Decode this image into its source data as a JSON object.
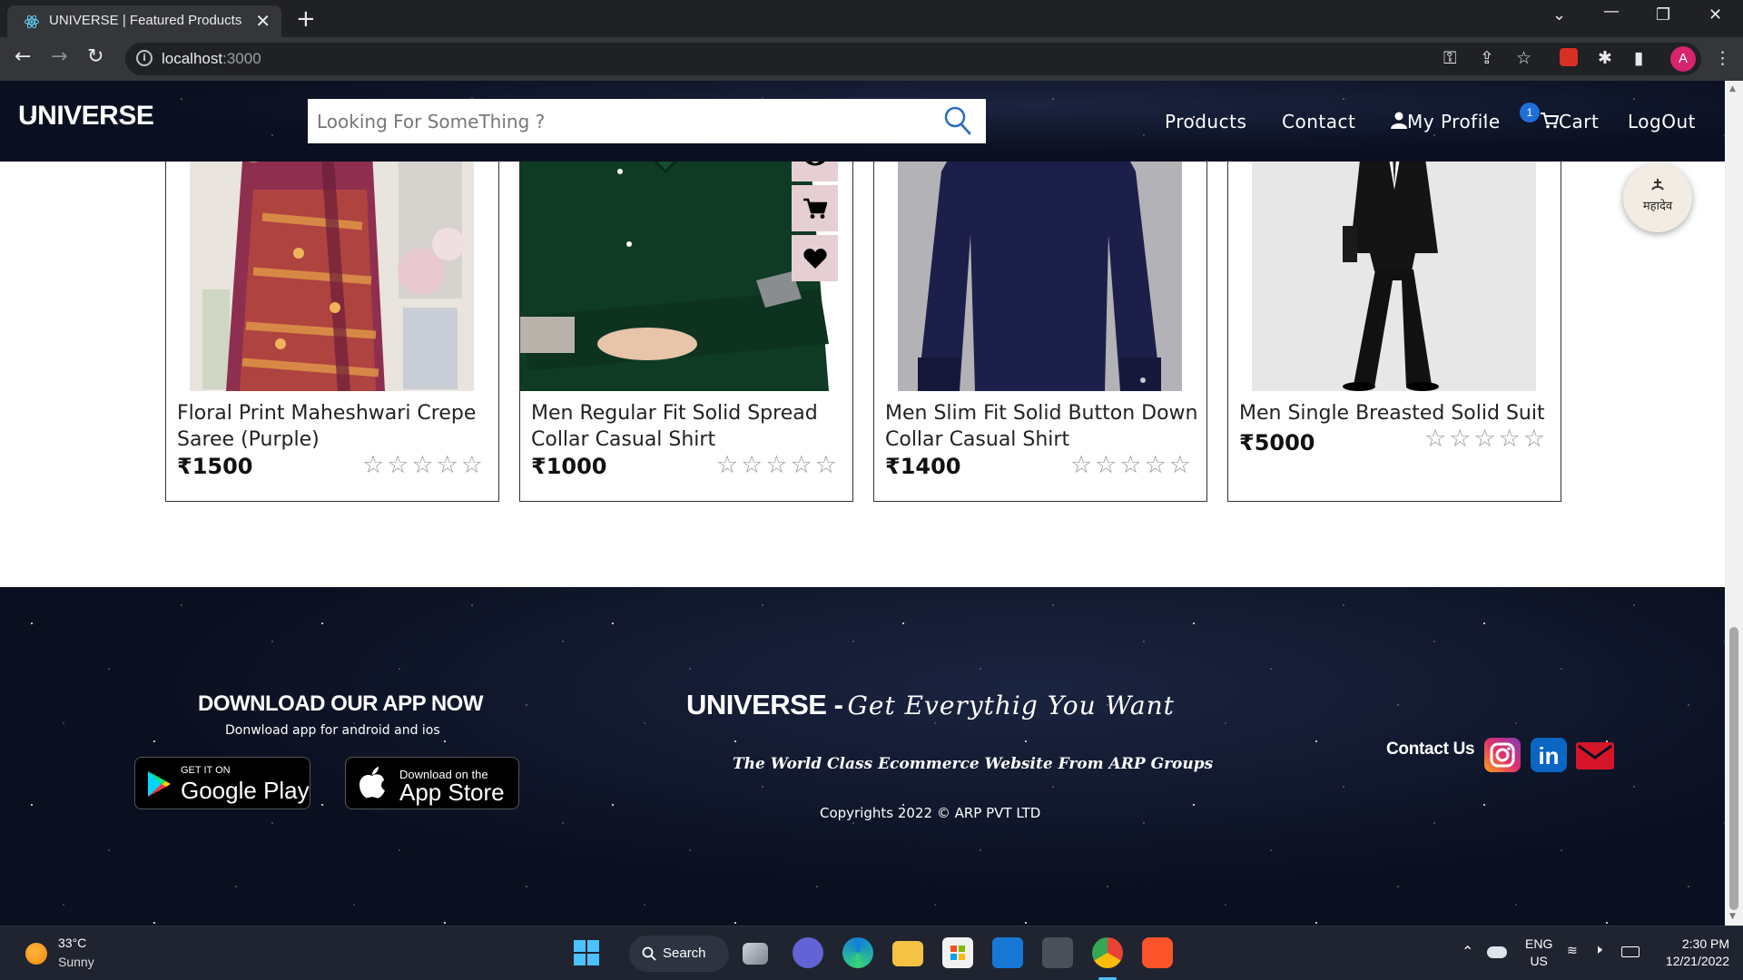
{
  "browser": {
    "tab_title": "UNIVERSE | Featured Products",
    "url_host": "localhost",
    "url_port": ":3000",
    "profile_initial": "A"
  },
  "header": {
    "brand": "UNIVERSE",
    "search_placeholder": "Looking For SomeThing ?",
    "nav": {
      "products": "Products",
      "contact": "Contact",
      "profile": "My Profile",
      "cart": "Cart",
      "logout": "LogOut"
    },
    "cart_count": "1"
  },
  "products": [
    {
      "name": "Floral Print Maheshwari Crepe Saree (Purple)",
      "price": "₹1500",
      "rating": "☆☆☆☆☆"
    },
    {
      "name": "Men Regular Fit Solid Spread Collar Casual Shirt",
      "price": "₹1000",
      "rating": "☆☆☆☆☆"
    },
    {
      "name": "Men Slim Fit Solid Button Down Collar Casual Shirt",
      "price": "₹1400",
      "rating": "☆☆☆☆☆"
    },
    {
      "name": "Men Single Breasted Solid Suit",
      "price": "₹5000",
      "rating": "☆☆☆☆☆"
    }
  ],
  "card_actions": [
    "eye-icon",
    "cart-icon",
    "heart-icon"
  ],
  "floating_logo_text": "महादेव",
  "footer": {
    "download_title": "DOWNLOAD OUR APP NOW",
    "download_sub": "Donwload app for android and ios",
    "google_play": {
      "small": "GET IT ON",
      "big": "Google Play"
    },
    "app_store": {
      "small": "Download on the",
      "big": "App Store"
    },
    "brand": "UNIVERSE -",
    "brand_tagline": "Get Everythig You Want",
    "tagline": "The World Class Ecommerce Website From ARP Groups",
    "copyright": "Copyrights 2022 © ARP PVT LTD",
    "contact_label": "Contact Us",
    "social": [
      "instagram-icon",
      "linkedin-icon",
      "mail-icon"
    ]
  },
  "taskbar": {
    "temperature": "33°C",
    "condition": "Sunny",
    "search_label": "Search",
    "lang_line1": "ENG",
    "lang_line2": "US",
    "time": "2:30 PM",
    "date": "12/21/2022"
  },
  "colors": {
    "header_bg": "#0b1020",
    "action_btn_bg": "#e6cfd3",
    "cart_badge": "#1e6fd9",
    "instagram": "#e1306c",
    "linkedin": "#0a66c2",
    "mail": "#d6152a"
  }
}
